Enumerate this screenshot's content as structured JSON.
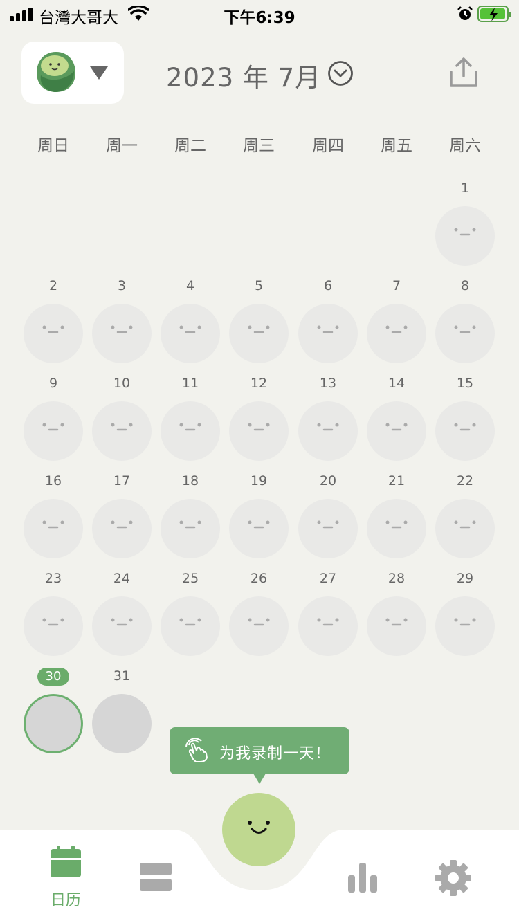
{
  "status_bar": {
    "carrier": "台灣大哥大",
    "time": "下午6:39",
    "icons": [
      "signal-icon",
      "wifi-icon",
      "alarm-icon",
      "battery-charging-icon"
    ]
  },
  "header": {
    "month_title": "2023 年 7月",
    "icons": [
      "avatar-icon",
      "dropdown-triangle-icon",
      "chevron-down-circle-icon",
      "share-icon"
    ]
  },
  "weekdays": [
    "周日",
    "周一",
    "周二",
    "周三",
    "周四",
    "周五",
    "周六"
  ],
  "calendar": {
    "first_weekday_index": 6,
    "days": [
      "1",
      "2",
      "3",
      "4",
      "5",
      "6",
      "7",
      "8",
      "9",
      "10",
      "11",
      "12",
      "13",
      "14",
      "15",
      "16",
      "17",
      "18",
      "19",
      "20",
      "21",
      "22",
      "23",
      "24",
      "25",
      "26",
      "27",
      "28",
      "29",
      "30",
      "31"
    ],
    "today": "30"
  },
  "tooltip": {
    "text": "为我录制一天！",
    "icon": "tap-hand-icon"
  },
  "tabbar": {
    "calendar_label": "日历",
    "icons": [
      "calendar-icon",
      "list-icon",
      "record-face-icon",
      "stats-icon",
      "settings-gear-icon"
    ]
  },
  "colors": {
    "accent_green": "#6aac6a",
    "record_button": "#bfd890",
    "background": "#f2f2ed",
    "mood_placeholder": "#e9e9e7"
  }
}
